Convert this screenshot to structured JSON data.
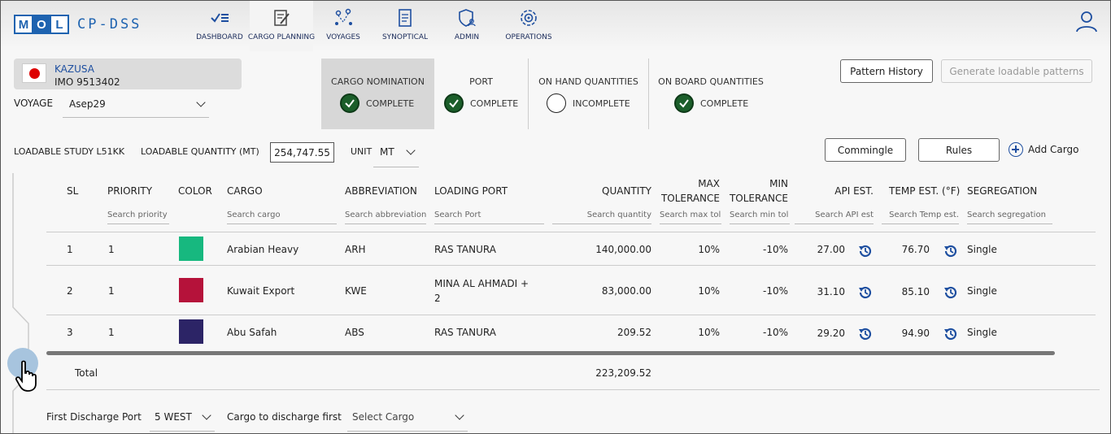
{
  "brand": {
    "logo_letters": [
      "M",
      "O",
      "L"
    ],
    "app_name": "CP-DSS",
    "brand_color": "#1e63b0"
  },
  "nav": [
    {
      "label": "DASHBOARD",
      "icon": "dashboard-icon"
    },
    {
      "label": "CARGO PLANNING",
      "icon": "cargo-planning-icon",
      "active": true
    },
    {
      "label": "VOYAGES",
      "icon": "voyages-icon"
    },
    {
      "label": "SYNOPTICAL",
      "icon": "synoptical-icon"
    },
    {
      "label": "ADMIN",
      "icon": "admin-icon"
    },
    {
      "label": "OPERATIONS",
      "icon": "operations-icon"
    }
  ],
  "vessel": {
    "name": "KAZUSA",
    "imo": "IMO 9513402",
    "flag": "japan-flag-icon"
  },
  "voyage": {
    "label": "VOYAGE",
    "value": "Asep29"
  },
  "status": [
    {
      "title": "CARGO NOMINATION",
      "state": "COMPLETE",
      "done": true,
      "active": true
    },
    {
      "title": "PORT",
      "state": "COMPLETE",
      "done": true
    },
    {
      "title": "ON HAND QUANTITIES",
      "state": "INCOMPLETE",
      "done": false
    },
    {
      "title": "ON BOARD QUANTITIES",
      "state": "COMPLETE",
      "done": true
    }
  ],
  "buttons": {
    "pattern_history": "Pattern History",
    "generate_patterns": "Generate loadable patterns",
    "commingle": "Commingle",
    "rules": "Rules",
    "add_cargo": "Add Cargo"
  },
  "study": {
    "label": "LOADABLE STUDY L51KK",
    "qty_label": "LOADABLE QUANTITY (MT)",
    "qty_value": "254,747.55",
    "unit_label": "UNIT",
    "unit_value": "MT"
  },
  "table": {
    "headers": {
      "sl": "SL",
      "priority": "PRIORITY",
      "color": "COLOR",
      "cargo": "CARGO",
      "abbreviation": "ABBREVIATION",
      "loading_port": "LOADING PORT",
      "quantity": "QUANTITY",
      "max_tol_1": "MAX",
      "max_tol_2": "TOLERANCE",
      "min_tol_1": "MIN",
      "min_tol_2": "TOLERANCE",
      "api": "API EST.",
      "temp": "TEMP EST. (°F)",
      "segregation": "SEGREGATION"
    },
    "search": {
      "priority": "Search priority",
      "cargo": "Search cargo",
      "abbreviation": "Search abbreviation",
      "port": "Search Port",
      "quantity": "Search quantity",
      "max_tol": "Search max tol",
      "min_tol": "Search min tol",
      "api": "Search API est",
      "temp": "Search Temp est.",
      "segregation": "Search segregation"
    },
    "rows": [
      {
        "sl": "1",
        "priority": "1",
        "color": "#17b87f",
        "cargo": "Arabian Heavy",
        "abbr": "ARH",
        "port": "RAS TANURA",
        "port2": "",
        "qty": "140,000.00",
        "max": "10%",
        "min": "-10%",
        "api": "27.00",
        "temp": "76.70",
        "seg": "Single"
      },
      {
        "sl": "2",
        "priority": "1",
        "color": "#b5123a",
        "cargo": "Kuwait Export",
        "abbr": "KWE",
        "port": "MINA AL AHMADI +",
        "port2": "2",
        "qty": "83,000.00",
        "max": "10%",
        "min": "-10%",
        "api": "31.10",
        "temp": "85.10",
        "seg": "Single"
      },
      {
        "sl": "3",
        "priority": "1",
        "color": "#2c2466",
        "cargo": "Abu Safah",
        "abbr": "ABS",
        "port": "RAS TANURA",
        "port2": "",
        "qty": "209.52",
        "max": "10%",
        "min": "-10%",
        "api": "29.20",
        "temp": "94.90",
        "seg": "Single"
      }
    ],
    "total_label": "Total",
    "total_value": "223,209.52"
  },
  "discharge": {
    "first_port_label": "First Discharge Port",
    "first_port_value": "5 WEST",
    "cargo_first_label": "Cargo to discharge first",
    "cargo_first_placeholder": "Select Cargo"
  }
}
